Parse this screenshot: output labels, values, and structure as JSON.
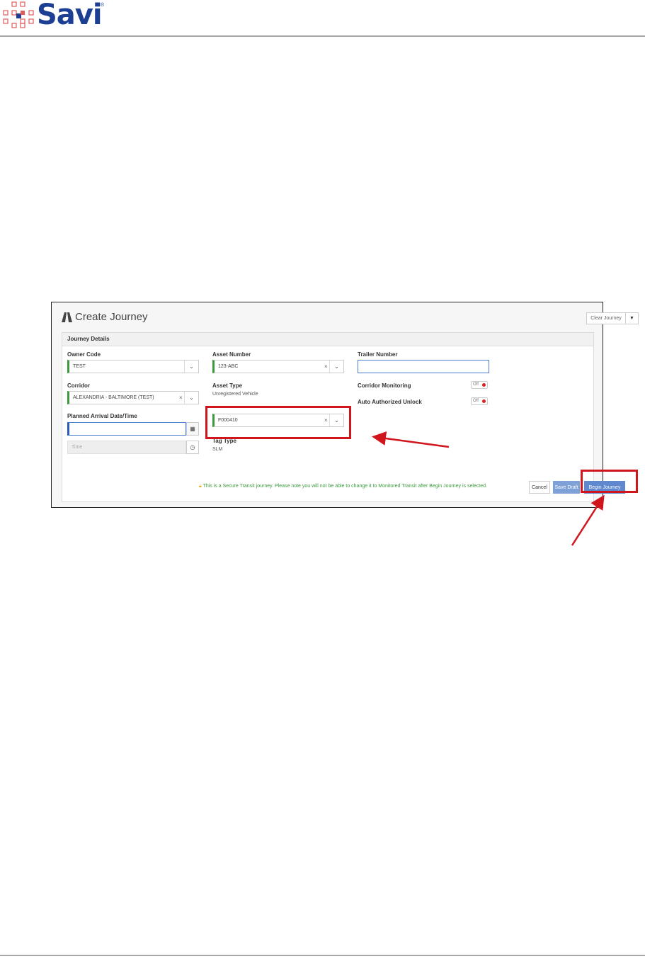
{
  "header": {
    "logo_text": "Savi",
    "logo_tm": "®"
  },
  "screenshot": {
    "title": "Create Journey",
    "clear_button": "Clear Journey",
    "panel_title": "Journey Details",
    "owner_code": {
      "label": "Owner Code",
      "value": "TEST"
    },
    "corridor": {
      "label": "Corridor",
      "value": "ALEXANDRIA - BALTIMORE (TEST)"
    },
    "planned_arrival": {
      "label": "Planned Arrival Date/Time",
      "value": "",
      "time_placeholder": "Time"
    },
    "asset_number": {
      "label": "Asset Number",
      "value": "123-ABC"
    },
    "asset_type": {
      "label": "Asset Type",
      "value": "Unregistered Vehicle"
    },
    "tracking_device": {
      "value": "F000410"
    },
    "tag_type": {
      "label": "Tag Type",
      "value": "SLM"
    },
    "trailer_number": {
      "label": "Trailer Number",
      "value": ""
    },
    "corridor_monitoring": {
      "label": "Corridor Monitoring",
      "state": "Off"
    },
    "auto_unlock": {
      "label": "Auto Authorized Unlock",
      "state": "Off"
    },
    "notice": "This is a Secure Transit journey. Please note you will not be able to change it to Monitored Transit after Begin Journey is selected.",
    "buttons": {
      "cancel": "Cancel",
      "save_draft": "Save Draft",
      "begin": "Begin Journey"
    }
  },
  "colors": {
    "brand_blue": "#1c3f94",
    "callout_red": "#d0161c",
    "valid_green": "#3c9a3c",
    "button_blue": "#5f88cf"
  },
  "icons": [
    "logo-grid-icon",
    "road-icon",
    "caret-down-icon",
    "calendar-icon",
    "clock-icon",
    "lock-icon",
    "clear-x-icon",
    "red-arrow-icon"
  ]
}
